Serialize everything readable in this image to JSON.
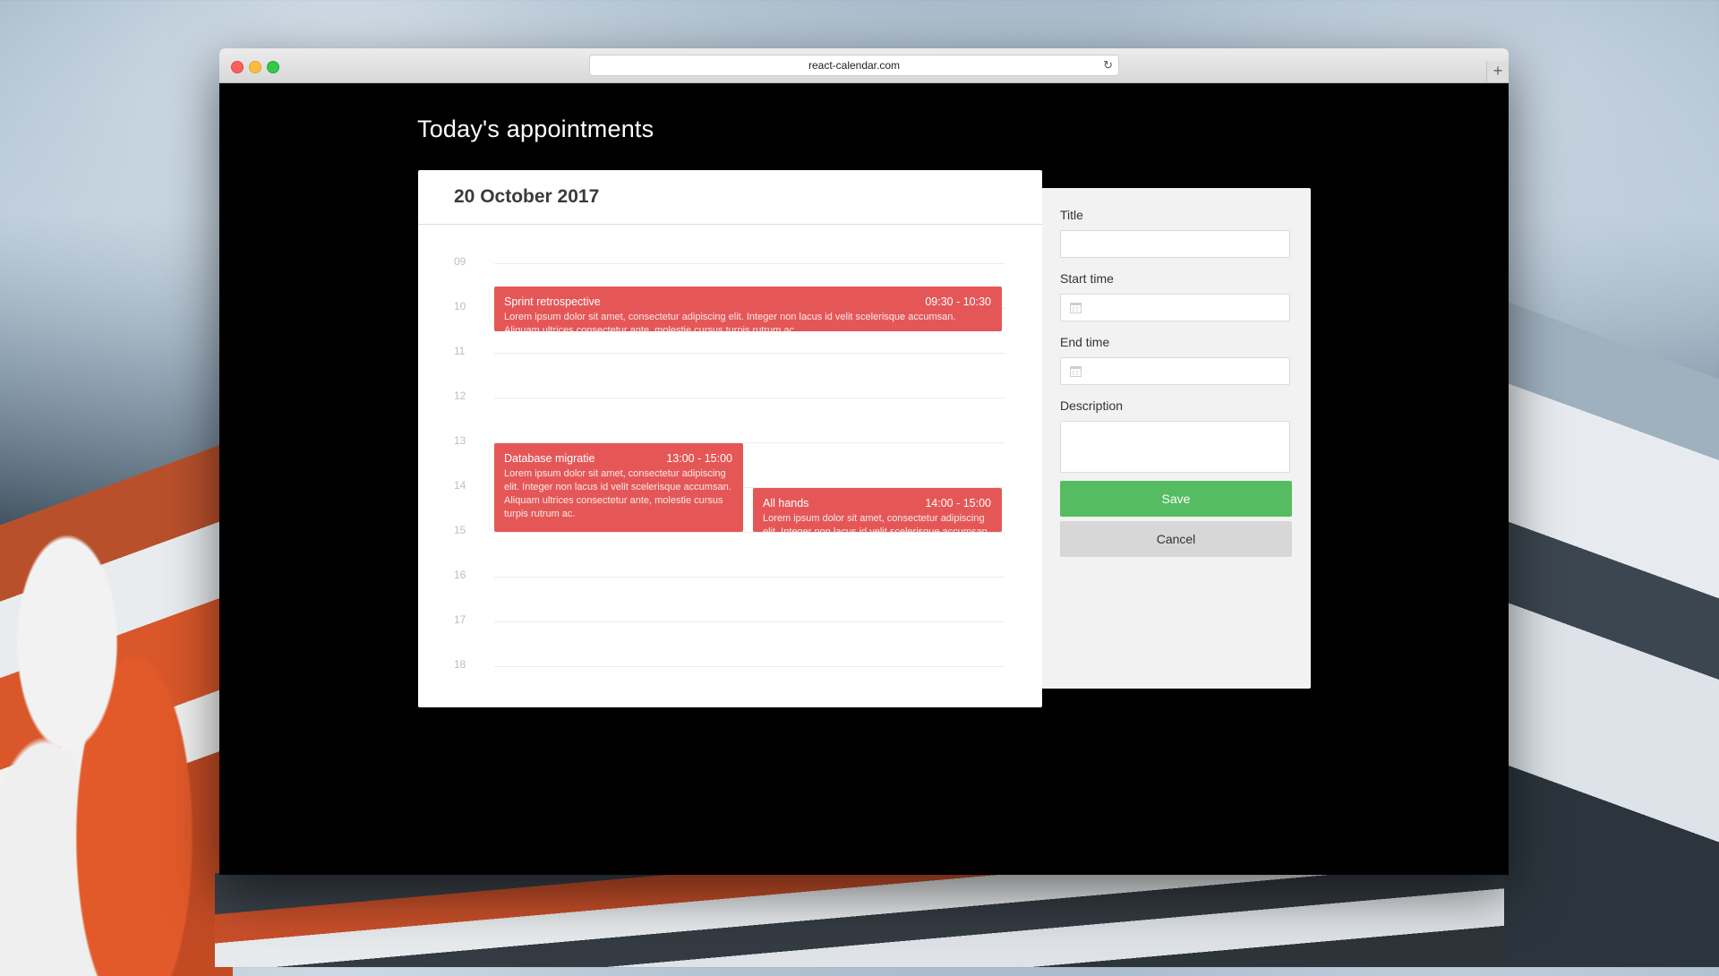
{
  "browser": {
    "url": "react-calendar.com",
    "new_tab": "+"
  },
  "page": {
    "title": "Today's appointments"
  },
  "calendar": {
    "date": "20 October 2017",
    "hours": [
      "09",
      "10",
      "11",
      "12",
      "13",
      "14",
      "15",
      "16",
      "17",
      "18"
    ],
    "events": [
      {
        "title": "Sprint retrospective",
        "time": "09:30 - 10:30",
        "description": "Lorem ipsum dolor sit amet, consectetur adipiscing elit. Integer non lacus id velit scelerisque accumsan. Aliquam ultrices consectetur ante, molestie cursus turpis rutrum ac."
      },
      {
        "title": "Database migratie",
        "time": "13:00 - 15:00",
        "description": "Lorem ipsum dolor sit amet, consectetur adipiscing elit. Integer non lacus id velit scelerisque accumsan. Aliquam ultrices consectetur ante, molestie cursus turpis rutrum ac."
      },
      {
        "title": "All hands",
        "time": "14:00 - 15:00",
        "description": "Lorem ipsum dolor sit amet, consectetur adipiscing elit. Integer non lacus id velit scelerisque accumsan."
      }
    ],
    "event_color": "#e55757"
  },
  "form": {
    "title_label": "Title",
    "title_value": "",
    "start_label": "Start time",
    "start_value": "",
    "end_label": "End time",
    "end_value": "",
    "description_label": "Description",
    "description_value": "",
    "save_label": "Save",
    "cancel_label": "Cancel",
    "save_color": "#55bc62"
  }
}
